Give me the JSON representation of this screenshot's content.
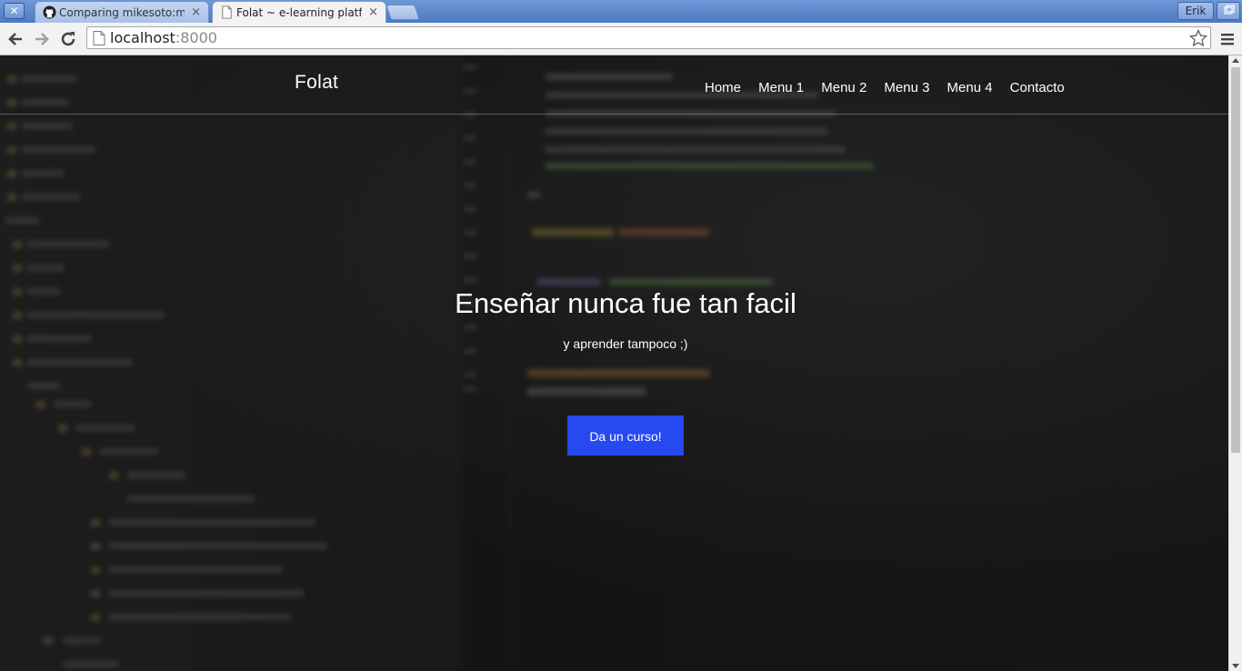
{
  "browser": {
    "tabs": [
      {
        "title": "Comparing mikesoto:mas",
        "close": "×",
        "icon": "github-icon",
        "active": false
      },
      {
        "title": "Folat ~ e-learning platform",
        "close": "×",
        "icon": "page-icon",
        "active": true
      }
    ],
    "profile_label": "Erik",
    "window_close": "✕",
    "address": {
      "host": "localhost",
      "port": ":8000"
    }
  },
  "site": {
    "brand": "Folat",
    "nav": [
      "Home",
      "Menu 1",
      "Menu 2",
      "Menu 3",
      "Menu 4",
      "Contacto"
    ]
  },
  "hero": {
    "title": "Enseñar nunca fue tan facil",
    "subtitle": "y aprender tampoco ;)",
    "cta_label": "Da un curso!",
    "cta_color": "#2749f0"
  }
}
